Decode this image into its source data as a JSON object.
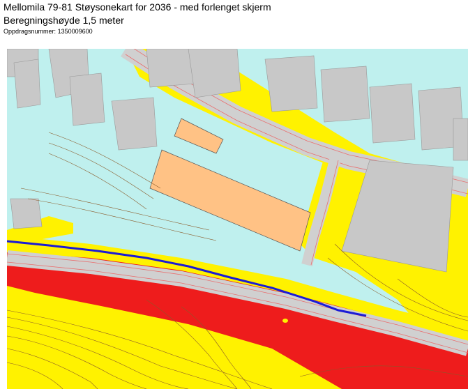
{
  "header": {
    "title": "Mellomila 79-81 Støysonekart  for 2036 - med forlenget skjerm",
    "subtitle": "Beregningshøyde 1,5 meter",
    "order_label": "Oppdragsnummer:",
    "order_number": "1350009600"
  },
  "map": {
    "colors": {
      "background_zone": "#bff0ee",
      "yellow_zone": "#fff200",
      "red_zone": "#ee1c1c",
      "existing_buildings": "#c8c8c8",
      "planned_buildings": "#ffc285",
      "road": "#d0d0d0",
      "road_lines": "#e87070",
      "noise_screen": "#1b1bd6",
      "contours": "#8a5a2a"
    }
  }
}
